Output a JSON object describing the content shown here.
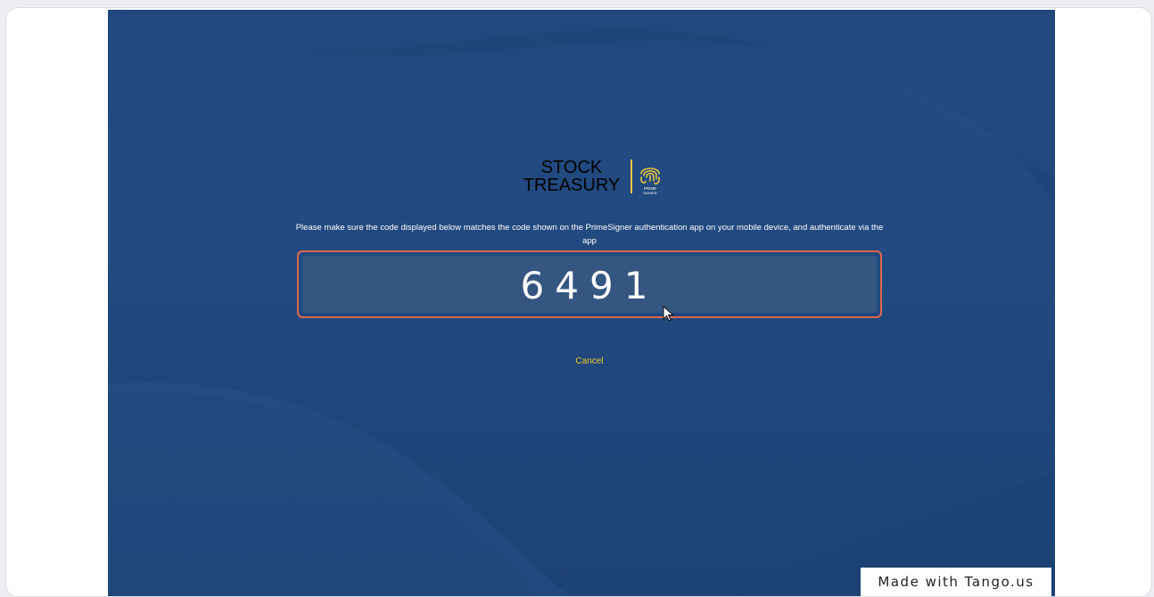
{
  "logo": {
    "line1": "STOCK",
    "line2": "TREASURY",
    "mark_label": "PRIME SIGNER"
  },
  "instruction": "Please make sure the code displayed below matches the code shown on the PrimeSigner authentication app on your mobile device, and authenticate via the app",
  "code": "6491",
  "cancel_label": "Cancel",
  "watermark": "Made with Tango.us",
  "colors": {
    "background": "#224a80",
    "code_box": "#345681",
    "highlight_border": "#e06650",
    "accent": "#f2c630"
  }
}
